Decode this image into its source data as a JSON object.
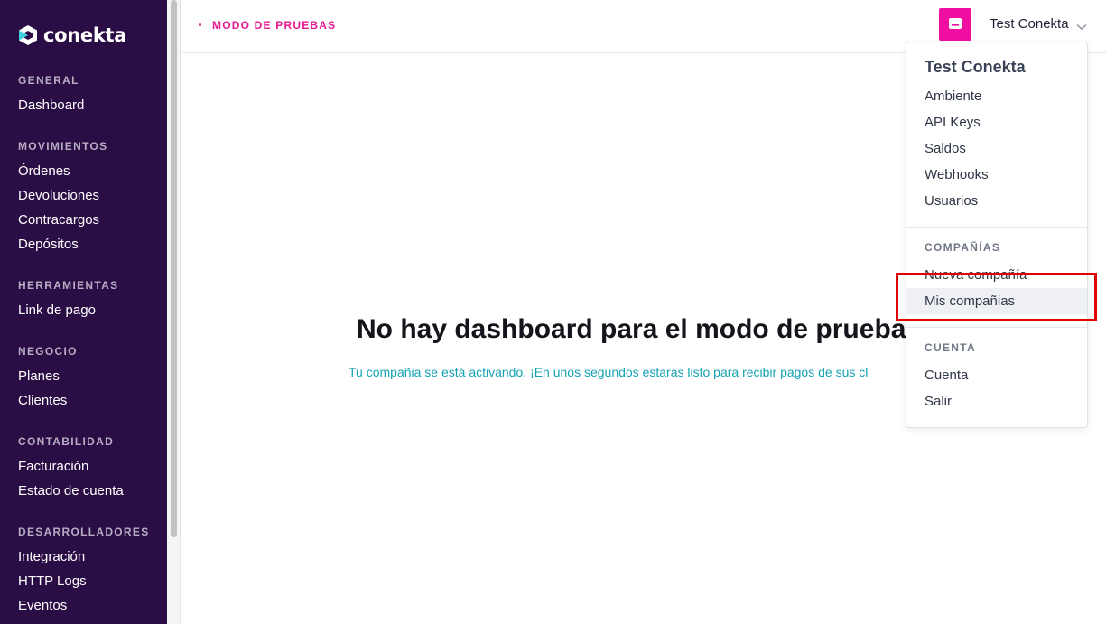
{
  "brand": {
    "logo_text": "conekta"
  },
  "sidebar": {
    "sections": [
      {
        "heading": "GENERAL",
        "items": [
          "Dashboard"
        ]
      },
      {
        "heading": "MOVIMIENTOS",
        "items": [
          "Órdenes",
          "Devoluciones",
          "Contracargos",
          "Depósitos"
        ]
      },
      {
        "heading": "HERRAMIENTAS",
        "items": [
          "Link de pago"
        ]
      },
      {
        "heading": "NEGOCIO",
        "items": [
          "Planes",
          "Clientes"
        ]
      },
      {
        "heading": "CONTABILIDAD",
        "items": [
          "Facturación",
          "Estado de cuenta"
        ]
      },
      {
        "heading": "DESARROLLADORES",
        "items": [
          "Integración",
          "HTTP Logs",
          "Eventos"
        ]
      }
    ]
  },
  "topbar": {
    "mode_label": "MODO DE PRUEBAS",
    "account_name": "Test Conekta",
    "avatar_icon": "chat-bubble-icon",
    "chevron_icon": "chevron-down-icon"
  },
  "main": {
    "title": "No hay dashboard para el modo de prueba",
    "subtitle": "Tu compañia se está activando. ¡En unos segundos estarás listo para recibir pagos de sus cl"
  },
  "dropdown": {
    "title": "Test Conekta",
    "account_items": [
      "Ambiente",
      "API Keys",
      "Saldos",
      "Webhooks",
      "Usuarios"
    ],
    "companies_heading": "COMPAÑÍAS",
    "company_items": [
      "Nueva compañía",
      "Mis compañias"
    ],
    "cuenta_heading": "CUENTA",
    "cuenta_items": [
      "Cuenta",
      "Salir"
    ]
  },
  "colors": {
    "sidebar_bg": "#2b0d45",
    "accent_pink": "#e8168f",
    "avatar_pink": "#ef0fa0",
    "subtitle_teal": "#14a3b3",
    "highlight_red": "#e00000"
  }
}
